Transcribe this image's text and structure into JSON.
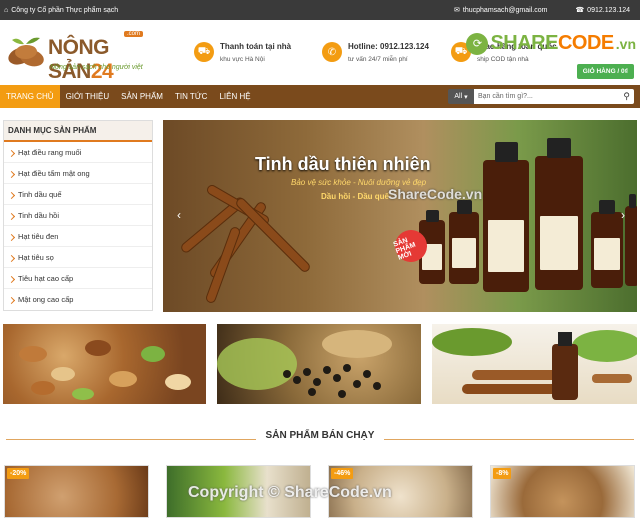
{
  "topbar": {
    "company": "Công ty Cổ phần Thực phẩm sạch",
    "email": "thucphamsach@gmail.com",
    "phone": "0912.123.124"
  },
  "logo": {
    "brand": "NÔNG SẢN",
    "brand_num": "24",
    "com": ".com",
    "slogan": "Nông sản sạch cho người việt"
  },
  "watermark_logo": {
    "prefix": "SHARE",
    "suffix": "CODE",
    "tld": ".vn"
  },
  "features": [
    {
      "title": "Thanh toán tại nhà",
      "sub": "khu vực Hà Nội"
    },
    {
      "title": "Hotline: 0912.123.124",
      "sub": "tư vấn 24/7 miễn phí"
    },
    {
      "title": "Giao hàng toàn quốc",
      "sub": "ship COD tận nhà"
    }
  ],
  "cart": {
    "label": "GIỎ HÀNG / 0₫"
  },
  "nav": {
    "items": [
      "TRANG CHỦ",
      "GIỚI THIỆU",
      "SẢN PHẨM",
      "TIN TỨC",
      "LIÊN HỆ"
    ],
    "active_index": 0,
    "search_select": "All",
    "search_placeholder": "Bạn cần tìm gì?..."
  },
  "sidebar": {
    "heading": "DANH MỤC SẢN PHẨM",
    "items": [
      "Hạt điều rang muối",
      "Hạt điều tẩm mật ong",
      "Tinh dầu quế",
      "Tinh dầu hồi",
      "Hạt tiêu đen",
      "Hạt tiêu sọ",
      "Tiêu hạt cao cấp",
      "Mật ong cao cấp"
    ]
  },
  "banner": {
    "title": "Tinh dầu thiên nhiên",
    "subtitle": "Bảo vệ sức khỏe - Nuôi dưỡng vẻ đẹp",
    "products": "Dầu hồi - Dầu quế",
    "new_badge": "SẢN PHẨM MỚI",
    "watermark": "ShareCode.vn"
  },
  "section_title": "SẢN PHẨM BÁN CHẠY",
  "products": [
    {
      "discount": "-20%"
    },
    {
      "discount": ""
    },
    {
      "discount": "-46%"
    },
    {
      "discount": "-8%"
    }
  ],
  "footer_watermark": "Copyright © ShareCode.vn",
  "colors": {
    "accent": "#f39c12",
    "nav": "#7a4a1c",
    "green": "#4caf50"
  }
}
